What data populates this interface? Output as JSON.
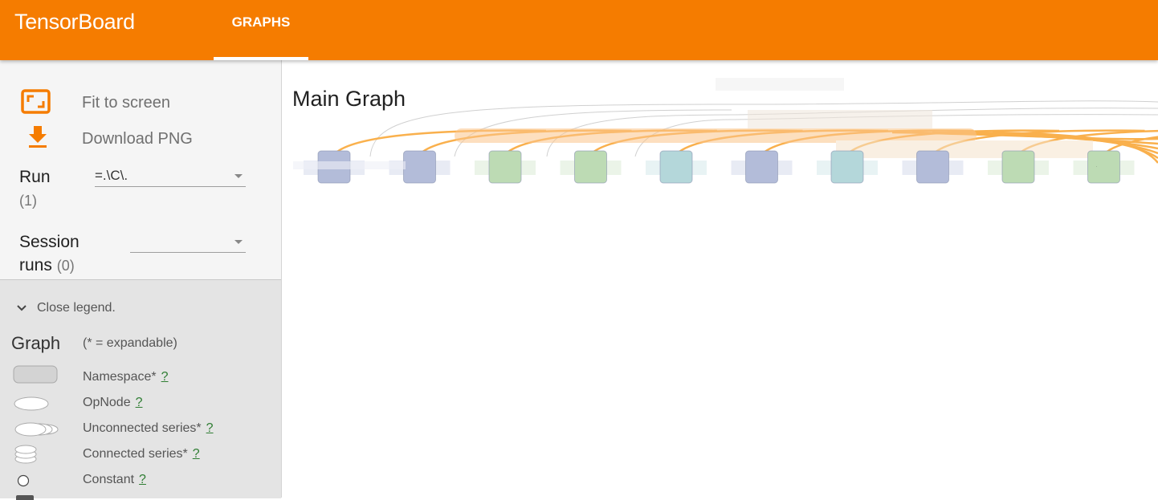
{
  "header": {
    "brand": "TensorBoard",
    "tab_label": "GRAPHS"
  },
  "sidebar": {
    "fit_label": "Fit to screen",
    "download_label": "Download PNG",
    "run_label": "Run",
    "run_count": "(1)",
    "run_value": "=.\\C\\.",
    "session_label_1": "Session",
    "session_label_2": "runs",
    "session_count": "(0)",
    "session_value": ""
  },
  "legend": {
    "close_label": "Close legend.",
    "title": "Graph",
    "subtitle": "(* = expandable)",
    "help_mark": "?",
    "items": [
      {
        "label": "Namespace*",
        "icon": "namespace-icon"
      },
      {
        "label": "OpNode",
        "icon": "opnode-icon"
      },
      {
        "label": "Unconnected series*",
        "icon": "unconnected-series-icon"
      },
      {
        "label": "Connected series*",
        "icon": "connected-series-icon"
      },
      {
        "label": "Constant",
        "icon": "constant-icon"
      }
    ]
  },
  "graph": {
    "title": "Main Graph",
    "node_colors": [
      "#b3bcd9",
      "#b3bcd9",
      "#bddbb4",
      "#bddbb4",
      "#b4d7da",
      "#b3bcd9",
      "#b4d7da",
      "#b3bcd9",
      "#bddbb4",
      "#bddbb4"
    ]
  },
  "colors": {
    "accent": "#f57c00",
    "edge": "#f9a83a",
    "link": "#2e7d32"
  }
}
